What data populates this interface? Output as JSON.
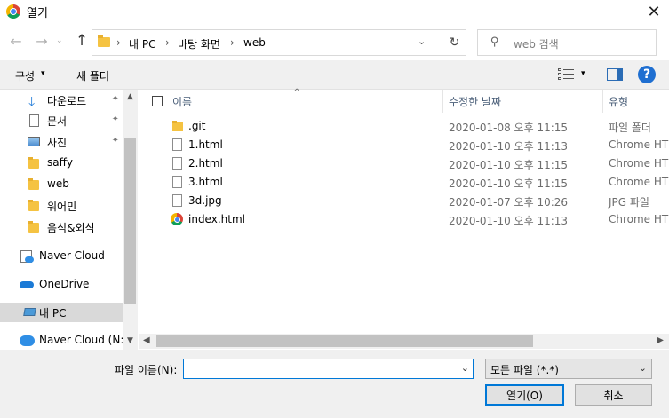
{
  "window": {
    "title": "열기",
    "close_glyph": "✕"
  },
  "nav": {
    "back_glyph": "←",
    "forward_glyph": "→",
    "recent_glyph": "⌄",
    "up_glyph": "↑",
    "breadcrumb": [
      "내 PC",
      "바탕 화면",
      "web"
    ],
    "separator": "›",
    "dropdown_glyph": "⌄",
    "refresh_glyph": "↻"
  },
  "search": {
    "placeholder": "web 검색"
  },
  "toolbar": {
    "organize_label": "구성",
    "organize_caret": "▾",
    "new_folder_label": "새 폴더",
    "view_caret": "▾",
    "help_label": "?"
  },
  "sidebar": {
    "items": [
      {
        "label": "다운로드",
        "icon": "download-icon",
        "pinned": true
      },
      {
        "label": "문서",
        "icon": "document-icon",
        "pinned": true
      },
      {
        "label": "사진",
        "icon": "pictures-icon",
        "pinned": true
      },
      {
        "label": "saffy",
        "icon": "folder-icon",
        "pinned": false
      },
      {
        "label": "web",
        "icon": "folder-icon",
        "pinned": false
      },
      {
        "label": "워어민",
        "icon": "folder-icon",
        "pinned": false
      },
      {
        "label": "음식&외식",
        "icon": "folder-icon",
        "pinned": false
      },
      {
        "label": "Naver Cloud",
        "icon": "naver-cloud-icon",
        "pinned": false
      },
      {
        "label": "OneDrive",
        "icon": "onedrive-icon",
        "pinned": false
      },
      {
        "label": "내 PC",
        "icon": "pc-icon",
        "pinned": false,
        "selected": true
      },
      {
        "label": "Naver Cloud (N:)",
        "icon": "naver-drive-icon",
        "pinned": false
      }
    ],
    "pin_glyph": "📌"
  },
  "list": {
    "columns": {
      "name": "이름",
      "date": "수정한 날짜",
      "type": "유형"
    },
    "sort_glyph": "^",
    "rows": [
      {
        "name": ".git",
        "date": "2020-01-08 오후 11:15",
        "type": "파일 폴더",
        "icon": "folder-icon"
      },
      {
        "name": "1.html",
        "date": "2020-01-10 오후 11:13",
        "type": "Chrome HTM",
        "icon": "file-icon"
      },
      {
        "name": "2.html",
        "date": "2020-01-10 오후 11:15",
        "type": "Chrome HTM",
        "icon": "file-icon"
      },
      {
        "name": "3.html",
        "date": "2020-01-10 오후 11:15",
        "type": "Chrome HTM",
        "icon": "file-icon"
      },
      {
        "name": "3d.jpg",
        "date": "2020-01-07 오후 10:26",
        "type": "JPG 파일",
        "icon": "file-icon"
      },
      {
        "name": "index.html",
        "date": "2020-01-10 오후 11:13",
        "type": "Chrome HTM",
        "icon": "chrome-icon"
      }
    ]
  },
  "scroll": {
    "up": "▲",
    "down": "▼",
    "left": "◀",
    "right": "▶"
  },
  "footer": {
    "filename_label": "파일 이름(N):",
    "filename_value": "",
    "filter_value": "모든 파일 (*.*)",
    "dropdown_glyph": "⌄",
    "open_label": "열기(O)",
    "cancel_label": "취소"
  }
}
